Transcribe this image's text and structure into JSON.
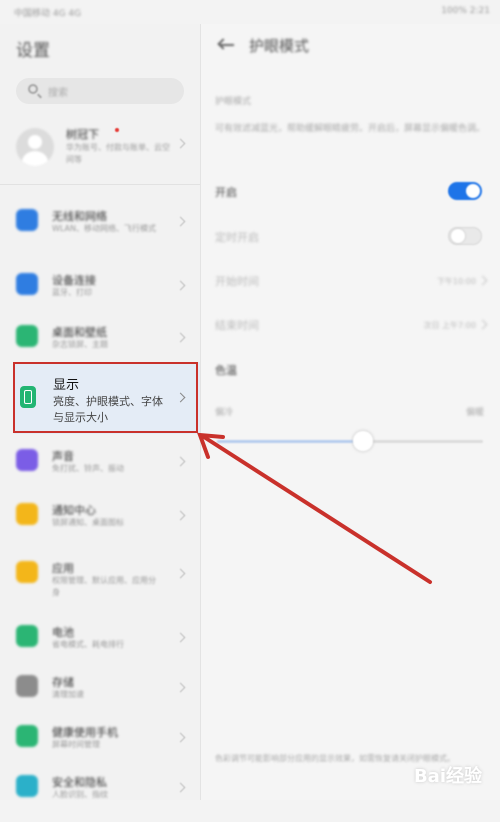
{
  "status_bar": {
    "carrier": "中国移动 4G 4G",
    "right": "100% 2:21"
  },
  "left": {
    "title": "设置",
    "search_placeholder": "搜索",
    "account": {
      "name": "树冠下",
      "desc": "华为账号、付款与账单、云空间等"
    },
    "items": [
      {
        "title": "无线和网络",
        "sub": "WLAN、移动网络、飞行模式",
        "color": "#2f7de1"
      },
      {
        "title": "设备连接",
        "sub": "蓝牙、打印",
        "color": "#2f7de1"
      },
      {
        "title": "桌面和壁纸",
        "sub": "杂志锁屏、主题",
        "color": "#2bb574"
      },
      {
        "title": "声音",
        "sub": "免打扰、铃声、振动",
        "color": "#7b5de6"
      },
      {
        "title": "通知中心",
        "sub": "锁屏通知、桌面图标",
        "color": "#f3b61a"
      },
      {
        "title": "应用",
        "sub": "权限管理、默认应用、应用分身",
        "color": "#f3b61a"
      },
      {
        "title": "电池",
        "sub": "省电模式、耗电排行",
        "color": "#2bb574"
      },
      {
        "title": "存储",
        "sub": "清理加速",
        "color": "#8c8c8c"
      },
      {
        "title": "健康使用手机",
        "sub": "屏幕时间管理",
        "color": "#2bb574"
      },
      {
        "title": "安全和隐私",
        "sub": "人脸识别、指纹",
        "color": "#2bb0c9"
      }
    ],
    "display_item": {
      "title": "显示",
      "sub": "亮度、护眼模式、字体与显示大小",
      "icon": "display-icon"
    }
  },
  "right": {
    "title": "护眼模式",
    "section_label": "护眼模式",
    "description": "可有效滤减蓝光，帮助缓解眼睛疲劳。开启后，屏幕显示偏暖色调。",
    "enable_label": "开启",
    "enable_on": true,
    "scheduled_label": "定时开启",
    "scheduled_on": false,
    "start_label": "开始时间",
    "start_value": "下午10:00",
    "end_label": "结束时间",
    "end_value": "次日 上午7:00",
    "color_temp_label": "色温",
    "slider_low": "偏冷",
    "slider_high": "偏暖",
    "slider_level": 0.55,
    "footer_note": "色彩调节可能影响部分应用的显示效果，如需恢复请关闭护眼模式。"
  },
  "watermark": "Bai经验",
  "colors": {
    "highlight_border": "#c9312b",
    "accent": "#1e74e8",
    "annotation_arrow": "#c9312b"
  }
}
